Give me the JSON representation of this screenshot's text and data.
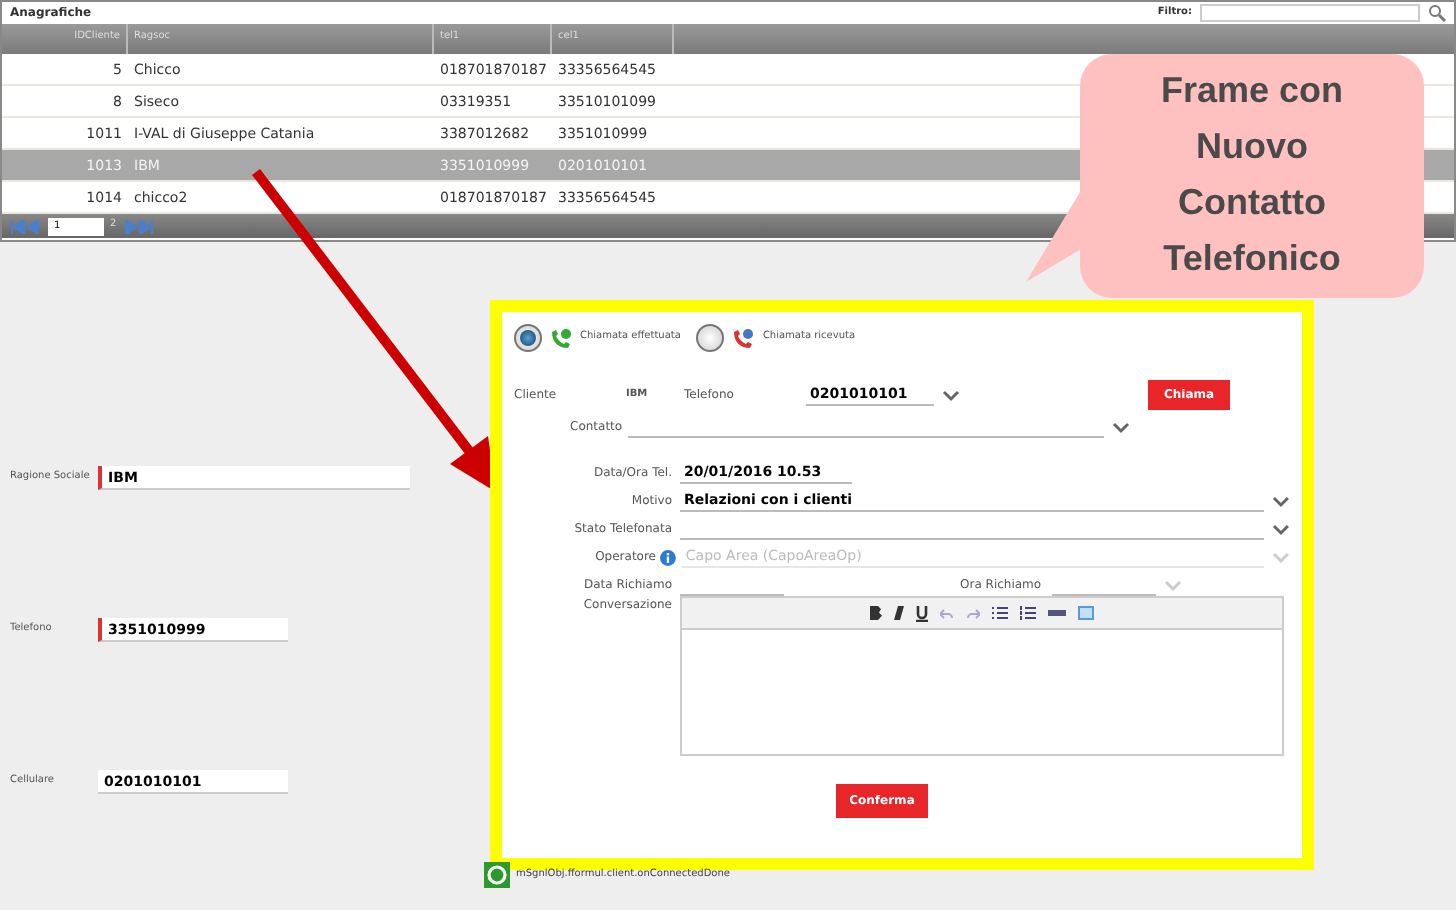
{
  "grid": {
    "title": "Anagrafiche",
    "filter": {
      "label": "Filtro:"
    },
    "columns": [
      "IDCliente",
      "Ragsoc",
      "tel1",
      "cel1"
    ],
    "rows": [
      {
        "cells": [
          "5",
          "Chicco",
          "018701870187",
          "33356564545"
        ],
        "selected": false
      },
      {
        "cells": [
          "8",
          "Siseco",
          "03319351",
          "33510101099"
        ],
        "selected": false
      },
      {
        "cells": [
          "1011",
          "I-VAL di Giuseppe Catania",
          "3387012682",
          "3351010999"
        ],
        "selected": false
      },
      {
        "cells": [
          "1013",
          "IBM",
          "3351010999",
          "0201010101"
        ],
        "selected": true
      },
      {
        "cells": [
          "1014",
          "chicco2",
          "018701870187",
          "33356564545"
        ],
        "selected": false
      }
    ],
    "pager": {
      "page": "1",
      "total": "2"
    }
  },
  "details": [
    {
      "label": "Ragione Sociale",
      "value": "IBM",
      "required": true
    },
    {
      "label": "Telefono",
      "value": "3351010999",
      "required": true
    },
    {
      "label": "Cellulare",
      "value": "0201010101",
      "required": false
    }
  ],
  "dialog": {
    "call_types": [
      {
        "label": "Chiamata effettuata",
        "selected": true
      },
      {
        "label": "Chiamata ricevuta",
        "selected": false
      }
    ],
    "cliente_label": "Cliente",
    "cliente_value": "IBM",
    "telefono_label": "Telefono",
    "telefono_value": "0201010101",
    "call_button": "Chiama",
    "contatto_label": "Contatto",
    "fields": [
      {
        "label": "Data/Ora Tel.",
        "value": "20/01/2016 10.53",
        "kind": "text",
        "disabled": false
      },
      {
        "label": "Motivo",
        "value": "Relazioni con i clienti",
        "kind": "select",
        "disabled": false
      },
      {
        "label": "Stato Telefonata",
        "kind": "select",
        "disabled": false
      },
      {
        "label": "Operatore",
        "value": "Capo Area (CapoAreaOp)",
        "kind": "select",
        "disabled": true,
        "info": true
      }
    ],
    "recall_date_label": "Data Richiamo",
    "recall_time_label": "Ora Richiamo",
    "conversation_label": "Conversazione",
    "confirm_button": "Conferma"
  },
  "callout": {
    "text": "Frame con Nuovo Contatto Telefonico"
  },
  "status": {
    "text": "mSgnlObj.fformul.client.onConnectedDone"
  }
}
